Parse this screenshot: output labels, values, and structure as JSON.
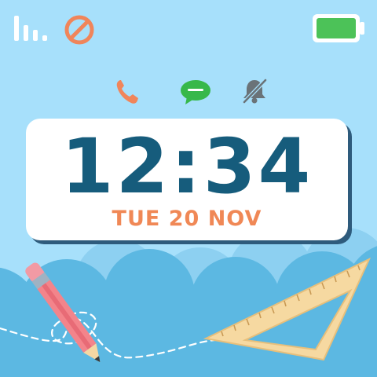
{
  "status_bar": {
    "signal_icon": "signal-bars-icon",
    "blocked_icon": "no-entry-icon",
    "battery_icon": "battery-full-icon",
    "battery_level": 1.0,
    "battery_color": "#4cc258",
    "blocked_color": "#f0855a"
  },
  "notifications": {
    "icons": [
      "phone-icon",
      "message-icon",
      "bell-muted-icon"
    ],
    "phone_color": "#f0855a",
    "message_color": "#37b84a",
    "bell_color": "#6a7378"
  },
  "clock": {
    "time": "12:34",
    "date": "TUE 20 NOV",
    "time_color": "#165c7c",
    "date_color": "#f08856"
  },
  "colors": {
    "sky": "#a7e0fb",
    "cloud_front": "#5cb8e2",
    "cloud_back": "#8dd0f1"
  }
}
